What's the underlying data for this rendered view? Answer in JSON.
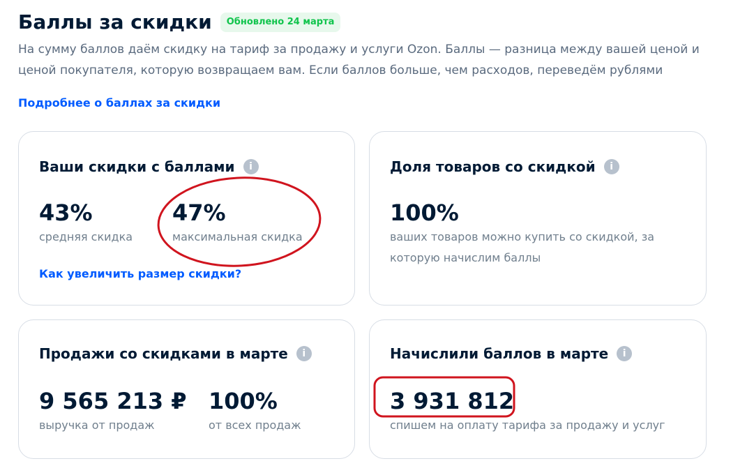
{
  "header": {
    "title": "Баллы за скидки",
    "badge": "Обновлено 24 марта"
  },
  "description": "На сумму баллов даём скидку на тариф за продажу и услуги Ozon. Баллы — разница между вашей ценой и ценой покупателя, которую возвращаем вам. Если баллов больше, чем расходов, переведём рублями",
  "more_link": "Подробнее о баллах за скидки",
  "cards": {
    "discounts": {
      "title": "Ваши скидки с баллами",
      "avg_value": "43%",
      "avg_label": "средняя скидка",
      "max_value": "47%",
      "max_label": "максимальная скидка",
      "link": "Как увеличить размер скидки?"
    },
    "share": {
      "title": "Доля товаров со скидкой",
      "value": "100%",
      "label": "ваших товаров можно купить со скидкой, за которую начислим баллы"
    },
    "sales": {
      "title": "Продажи со скидками в марте",
      "revenue_value": "9 565 213 ₽",
      "revenue_label": "выручка от продаж",
      "share_value": "100%",
      "share_label": "от всех продаж"
    },
    "points": {
      "title": "Начислили баллов в марте",
      "value": "3 931 812",
      "label": "спишем на оплату тарифа за продажу и услуг"
    }
  },
  "info_glyph": "i",
  "colors": {
    "accent_link": "#005bff",
    "badge_text": "#10c44c",
    "badge_bg": "#e7f8ec",
    "annotation": "#d0141e"
  }
}
